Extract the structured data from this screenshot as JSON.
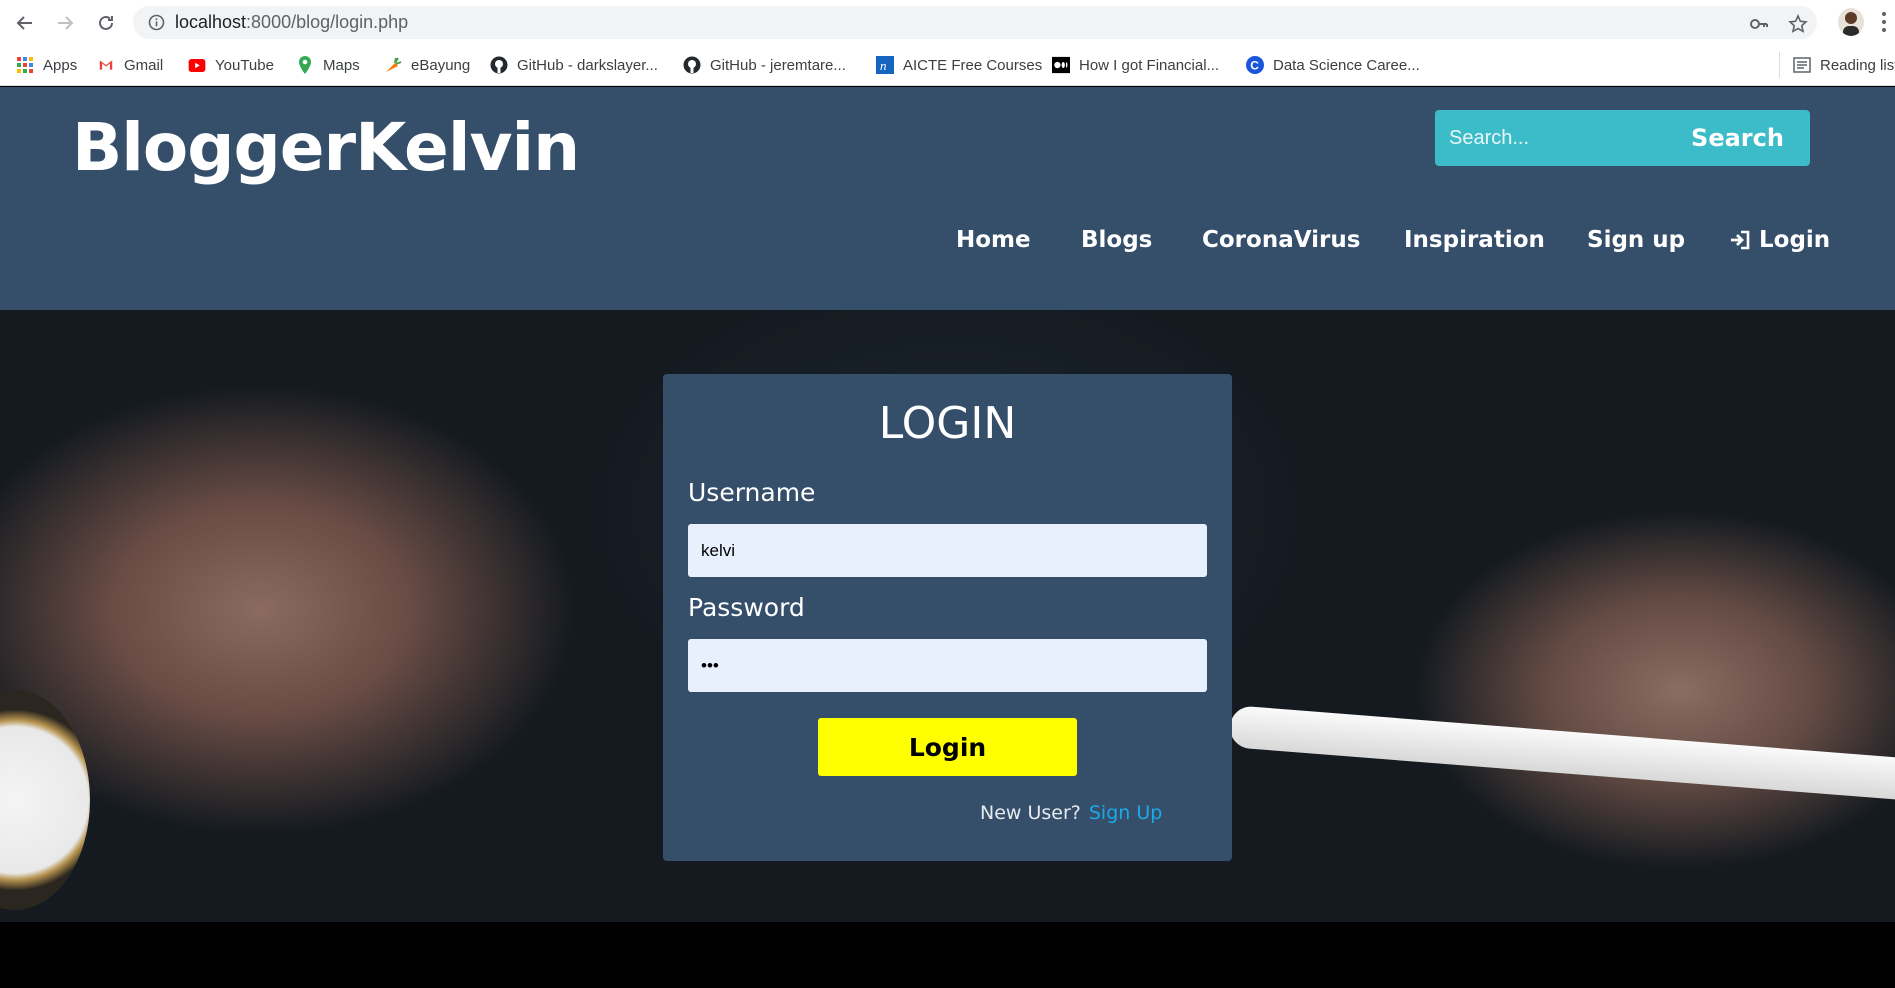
{
  "browser": {
    "url_host": "localhost",
    "url_rest": ":8000/blog/login.php",
    "bookmarks": [
      {
        "label": "Apps",
        "icon": "apps-grid-icon"
      },
      {
        "label": "Gmail",
        "icon": "gmail-icon"
      },
      {
        "label": "YouTube",
        "icon": "youtube-icon"
      },
      {
        "label": "Maps",
        "icon": "maps-pin-icon"
      },
      {
        "label": "eBayung",
        "icon": "carrot-icon"
      },
      {
        "label": "GitHub - darkslayer...",
        "icon": "github-icon"
      },
      {
        "label": "GitHub - jeremtare...",
        "icon": "github-icon"
      },
      {
        "label": "AICTE Free Courses",
        "icon": "nptel-icon"
      },
      {
        "label": "How I got Financial...",
        "icon": "medium-icon"
      },
      {
        "label": "Data Science Caree...",
        "icon": "c-logo-icon"
      },
      {
        "label": "Reading list",
        "icon": "reading-list-icon"
      }
    ]
  },
  "site": {
    "logo": "BloggerKelvin",
    "search": {
      "placeholder": "Search...",
      "button": "Search"
    },
    "nav": [
      "Home",
      "Blogs",
      "CoronaVirus",
      "Inspiration",
      "Sign up",
      "Login"
    ],
    "colors": {
      "header": "#354e69",
      "search": "#3cbcc9",
      "login_button": "#ffff00",
      "link": "#1ca9e8"
    }
  },
  "login": {
    "title": "LOGIN",
    "username_label": "Username",
    "username_value": "kelvi",
    "password_label": "Password",
    "password_value": "•••",
    "button": "Login",
    "new_user_text": "New User?",
    "signup_link": "Sign Up"
  }
}
